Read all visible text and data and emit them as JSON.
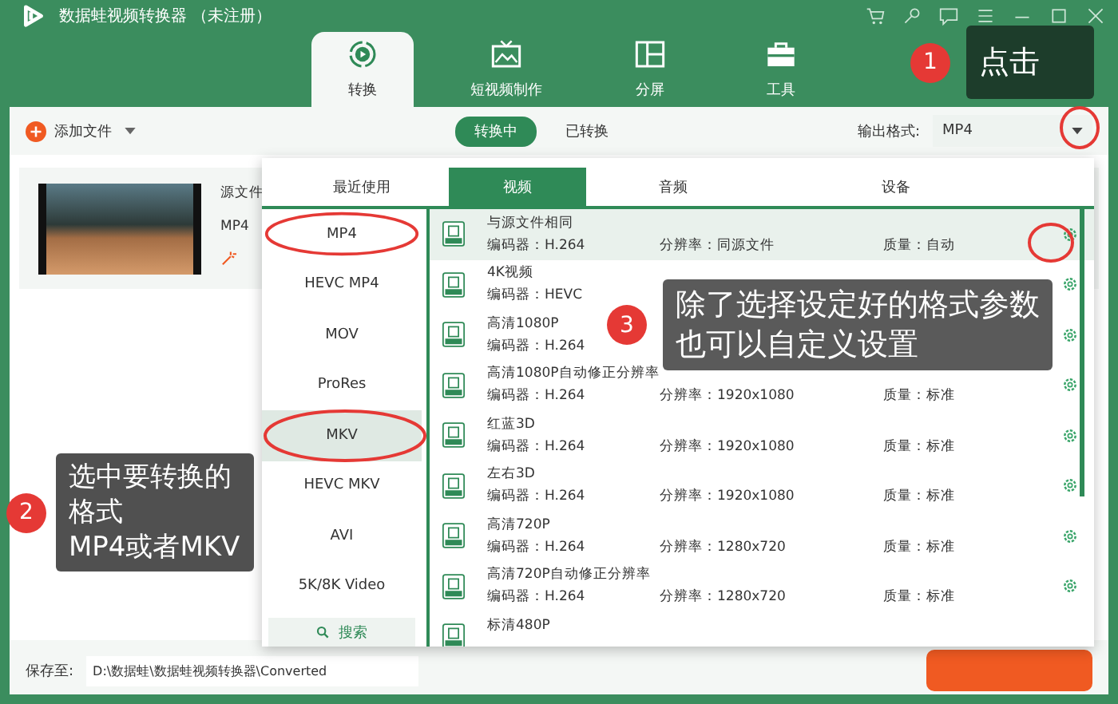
{
  "window": {
    "title": "数据蛙视频转换器 （未注册）"
  },
  "nav_tabs": [
    {
      "label": "转换",
      "selected": true
    },
    {
      "label": "短视频制作",
      "selected": false
    },
    {
      "label": "分屏",
      "selected": false
    },
    {
      "label": "工具",
      "selected": false
    }
  ],
  "toolbar": {
    "add_button": "添加文件",
    "status_tabs": [
      {
        "label": "转换中",
        "selected": true
      },
      {
        "label": "已转换",
        "selected": false
      }
    ],
    "output_format_label": "输出格式:",
    "output_format": "MP4"
  },
  "file": {
    "name": "源文件",
    "format": "MP4"
  },
  "save": {
    "label": "保存至:",
    "path": "D:\\数据蛙\\数据蛙视频转换器\\Converted"
  },
  "format_panel": {
    "tabs": [
      {
        "label": "最近使用",
        "selected": false
      },
      {
        "label": "视频",
        "selected": true
      },
      {
        "label": "音频",
        "selected": false
      },
      {
        "label": "设备",
        "selected": false
      }
    ],
    "formats": [
      {
        "label": "MP4",
        "selected": false
      },
      {
        "label": "HEVC MP4",
        "selected": false
      },
      {
        "label": "MOV",
        "selected": false
      },
      {
        "label": "ProRes",
        "selected": false
      },
      {
        "label": "MKV",
        "selected": true
      },
      {
        "label": "HEVC MKV",
        "selected": false
      },
      {
        "label": "AVI",
        "selected": false
      },
      {
        "label": "5K/8K Video",
        "selected": false
      }
    ],
    "search": "搜索",
    "presets": [
      {
        "title": "与源文件相同",
        "encoder": "编码器：H.264",
        "resolution": "分辨率：同源文件",
        "quality": "质量：自动",
        "selected": true
      },
      {
        "title": "4K视频",
        "encoder": "编码器：HEVC",
        "selected": false
      },
      {
        "title": "高清1080P",
        "encoder": "编码器：H.264",
        "selected": false
      },
      {
        "title": "高清1080P自动修正分辨率",
        "encoder": "编码器：H.264",
        "resolution": "分辨率：1920x1080",
        "quality": "质量：标准",
        "selected": false
      },
      {
        "title": "红蓝3D",
        "encoder": "编码器：H.264",
        "resolution": "分辨率：1920x1080",
        "quality": "质量：标准",
        "selected": false
      },
      {
        "title": "左右3D",
        "encoder": "编码器：H.264",
        "resolution": "分辨率：1920x1080",
        "quality": "质量：标准",
        "selected": false
      },
      {
        "title": "高清720P",
        "encoder": "编码器：H.264",
        "resolution": "分辨率：1280x720",
        "quality": "质量：标准",
        "selected": false
      },
      {
        "title": "高清720P自动修正分辨率",
        "encoder": "编码器：H.264",
        "resolution": "分辨率：1280x720",
        "quality": "质量：标准",
        "selected": false
      },
      {
        "title": "标清480P",
        "selected": false
      }
    ]
  },
  "callouts": [
    {
      "number": "1",
      "lines": [
        "点击"
      ]
    },
    {
      "number": "2",
      "lines": [
        "选中要转换的格式",
        "MP4或者MKV"
      ]
    },
    {
      "number": "3",
      "lines": [
        "除了选择设定好的格式参数",
        "也可以自定义设置"
      ]
    }
  ]
}
